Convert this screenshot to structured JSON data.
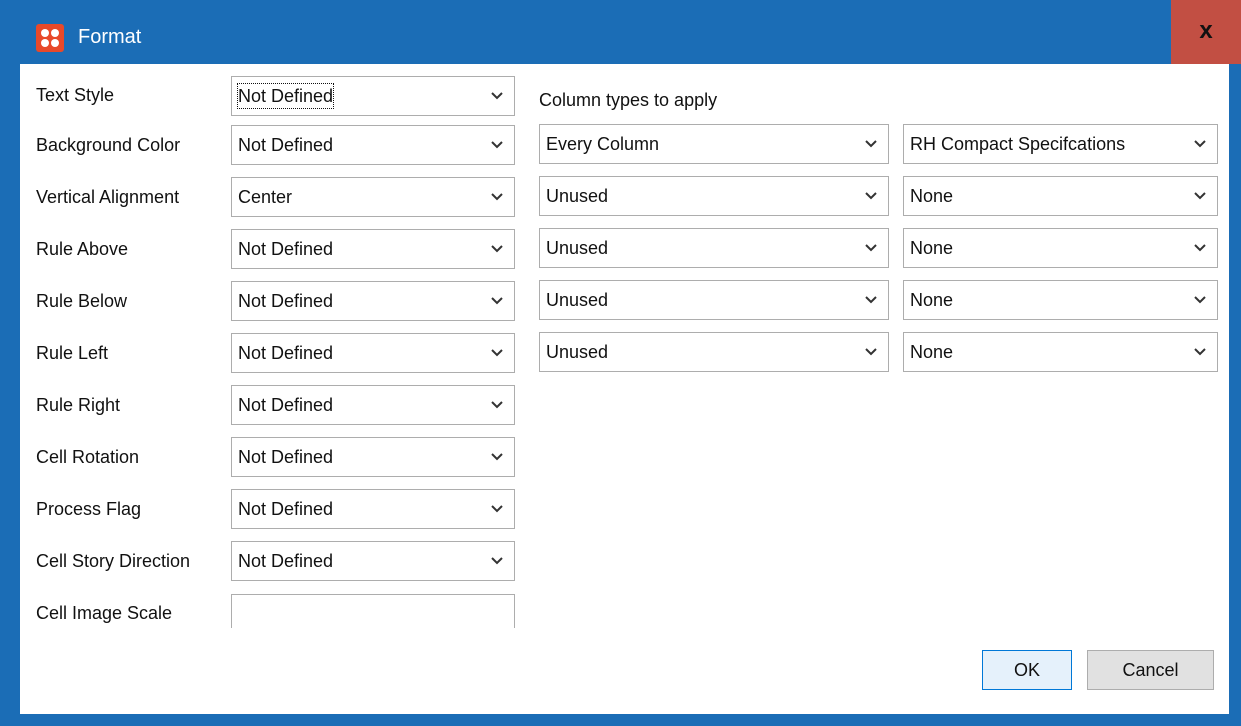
{
  "window": {
    "title": "Format",
    "close_glyph": "x",
    "app_icon": "app-icon"
  },
  "left_fields": [
    {
      "label": "Text Style",
      "value": "Not Defined"
    },
    {
      "label": "Background Color",
      "value": "Not Defined"
    },
    {
      "label": "Vertical Alignment",
      "value": "Center"
    },
    {
      "label": "Rule Above",
      "value": "Not Defined"
    },
    {
      "label": "Rule Below",
      "value": "Not Defined"
    },
    {
      "label": "Rule Left",
      "value": "Not Defined"
    },
    {
      "label": "Rule Right",
      "value": "Not Defined"
    },
    {
      "label": "Cell Rotation",
      "value": "Not Defined"
    },
    {
      "label": "Process Flag",
      "value": "Not Defined"
    },
    {
      "label": "Cell Story Direction",
      "value": "Not Defined"
    }
  ],
  "image_scale": {
    "label": "Cell Image Scale",
    "value": ""
  },
  "column_types": {
    "header": "Column types to apply",
    "rows": [
      {
        "column": "Every Column",
        "style": "RH Compact Specifcations"
      },
      {
        "column": "Unused",
        "style": "None"
      },
      {
        "column": "Unused",
        "style": "None"
      },
      {
        "column": "Unused",
        "style": "None"
      },
      {
        "column": "Unused",
        "style": "None"
      }
    ]
  },
  "buttons": {
    "ok": "OK",
    "cancel": "Cancel"
  },
  "colors": {
    "title_bar": "#1b6db6",
    "close_button": "#c24f43",
    "app_icon": "#e8492a",
    "default_button_border": "#0078d7"
  }
}
